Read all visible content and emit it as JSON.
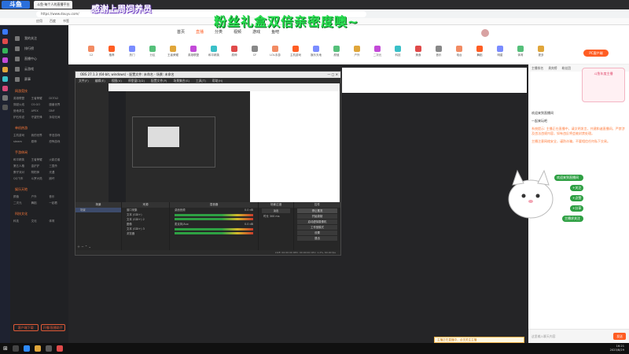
{
  "overlay": {
    "logo": "斗鱼",
    "thanks_banner": "感谢上周饲养员",
    "fans_banner": "粉丝礼盒双倍亲密度噢~"
  },
  "browser": {
    "tabs": [
      "斗鱼-每个人的直播平台",
      "",
      ""
    ],
    "url": "https://www.douyu.com/",
    "bookmarks": [
      "应用",
      "百度",
      "书签"
    ]
  },
  "site": {
    "nav": [
      "首页",
      "直播",
      "分类",
      "视频",
      "游戏",
      "鱼吧"
    ],
    "nav_active": 1,
    "categories": [
      "12",
      "推荐",
      "热门",
      "分区",
      "王者荣耀",
      "英雄联盟",
      "和平精英",
      "原神",
      "CF",
      "LOL手游",
      "主机游戏",
      "娱乐天地",
      "颜值",
      "户外",
      "二次元",
      "科技",
      "美食",
      "音乐",
      "电台",
      "舞蹈",
      "明星",
      "体育",
      "更多"
    ],
    "pc_button": "PC客户端"
  },
  "sidebar": {
    "items": [
      "我的关注",
      "排行榜",
      "直播中心",
      "云游戏",
      "赛事"
    ],
    "sections": [
      {
        "title": "网游竞技",
        "items": [
          "英雄联盟",
          "王者荣耀",
          "DOTA2",
          "穿越火线",
          "CS:GO",
          "魔兽世界",
          "绝地求生",
          "APEX",
          "DNF",
          "炉石传说",
          "守望先锋",
          "永劫无间"
        ]
      },
      {
        "title": "单机热游",
        "items": [
          "主机游戏",
          "我的世界",
          "怀旧游戏",
          "steam",
          "原神",
          "恐怖游戏"
        ]
      },
      {
        "title": "手游休闲",
        "items": [
          "和平精英",
          "王者荣耀",
          "火影忍者",
          "第五人格",
          "金铲铲",
          "三国杀",
          "蛋仔派对",
          "阴阳师",
          "光遇",
          "QQ飞车",
          "斗罗大陆",
          "崩坏"
        ]
      },
      {
        "title": "娱乐天地",
        "items": [
          "颜值",
          "户外",
          "音乐",
          "二次元",
          "舞蹈",
          "一起看"
        ]
      },
      {
        "title": "科技文化",
        "items": [
          "科技",
          "文化",
          "体育"
        ]
      }
    ],
    "bottom_buttons": [
      "客户端下载",
      "开播/直播助手"
    ]
  },
  "obs": {
    "title": "OBS 27.1.3 (64-bit, windows) - 配置文件: 未命名 - 场景: 未命名",
    "menu": [
      "文件(F)",
      "编辑(E)",
      "视图(V)",
      "停靠窗口(D)",
      "配置文件(P)",
      "场景集合(S)",
      "工具(T)",
      "帮助(H)"
    ],
    "docks": {
      "scenes": {
        "header": "场景",
        "items": [
          "场景"
        ]
      },
      "sources": {
        "header": "来源",
        "items": [
          "窗口采集",
          "文本 (GDI+)",
          "文本 (GDI+) 2",
          "图像",
          "文本 (GDI+) 3",
          "浏览器"
        ]
      },
      "mixer": {
        "header": "混音器",
        "channels": [
          {
            "name": "桌面音频",
            "db": "0.0 dB"
          },
          {
            "name": "麦克风/Aux",
            "db": "0.0 dB"
          }
        ]
      },
      "transitions": {
        "header": "场景过渡",
        "type": "淡出",
        "duration_label": "时长",
        "duration": "300 ms"
      },
      "controls": {
        "header": "控件",
        "buttons": [
          "停止推流",
          "开始录制",
          "启动虚拟摄像机",
          "工作室模式",
          "设置",
          "退出"
        ]
      }
    },
    "status": "LIVE: 00:00:00  REC: 00:00:00  CPU: 1.2%, 60.00 fps"
  },
  "chat": {
    "header": [
      "主播排名",
      "贵宾榜",
      "粉丝团"
    ],
    "messages": [
      {
        "user": "欢迎来到直播间",
        "text": ""
      },
      {
        "user": "",
        "text": "一起来玩吧"
      },
      {
        "user": "系统提示",
        "text": "主播正在直播中，请文明发言，共建和谐直播间，严禁涉及违法违规内容，如有违反将会被封禁处理。"
      },
      {
        "user": "",
        "text": "主播注意网络安全，谨防诈骗，不要相信任何私下交易。"
      }
    ],
    "floating": [
      "欢迎来到直播间",
      "+关注",
      "+点赞",
      "+分享",
      "主播求关注"
    ],
    "brand": "斗鱼年度主播",
    "input_placeholder": "这里输入聊天内容",
    "send": "发送"
  },
  "tip": "主播正在直播中，点击关注主播",
  "taskbar": {
    "time": "16:21",
    "date": "2023/8/29"
  },
  "colors": {
    "accent": "#ff5d23",
    "banner_green": "#2ae052",
    "obs_bg": "#2b2b2b"
  }
}
